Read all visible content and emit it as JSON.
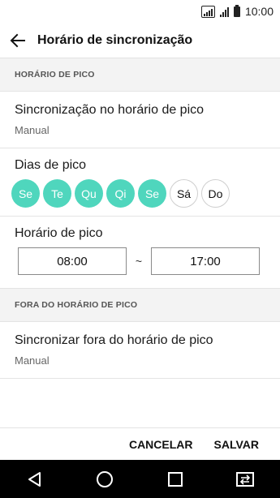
{
  "status_bar": {
    "time": "10:00"
  },
  "app_bar": {
    "title": "Horário de sincronização",
    "back_icon": "arrow-left-icon"
  },
  "peak_section": {
    "header": "HORÁRIO DE PICO",
    "sync_item": {
      "title": "Sincronização no horário de pico",
      "value": "Manual"
    },
    "days_item": {
      "title": "Dias de pico",
      "days": [
        {
          "label": "Se",
          "selected": true
        },
        {
          "label": "Te",
          "selected": true
        },
        {
          "label": "Qu",
          "selected": true
        },
        {
          "label": "Qi",
          "selected": true
        },
        {
          "label": "Se",
          "selected": true
        },
        {
          "label": "Sá",
          "selected": false
        },
        {
          "label": "Do",
          "selected": false
        }
      ]
    },
    "time_item": {
      "title": "Horário de pico",
      "start": "08:00",
      "separator": "~",
      "end": "17:00"
    }
  },
  "offpeak_section": {
    "header": "FORA DO HORÁRIO DE PICO",
    "sync_item": {
      "title": "Sincronizar fora do horário de pico",
      "value": "Manual"
    }
  },
  "footer": {
    "cancel_label": "CANCELAR",
    "save_label": "SALVAR"
  },
  "nav_bar": {
    "icons": [
      "back-triangle-icon",
      "home-circle-icon",
      "recents-square-icon",
      "dual-window-icon"
    ]
  },
  "colors": {
    "accent": "#4fd6bd",
    "navbar": "#000000",
    "section_bg": "#f3f3f3"
  }
}
